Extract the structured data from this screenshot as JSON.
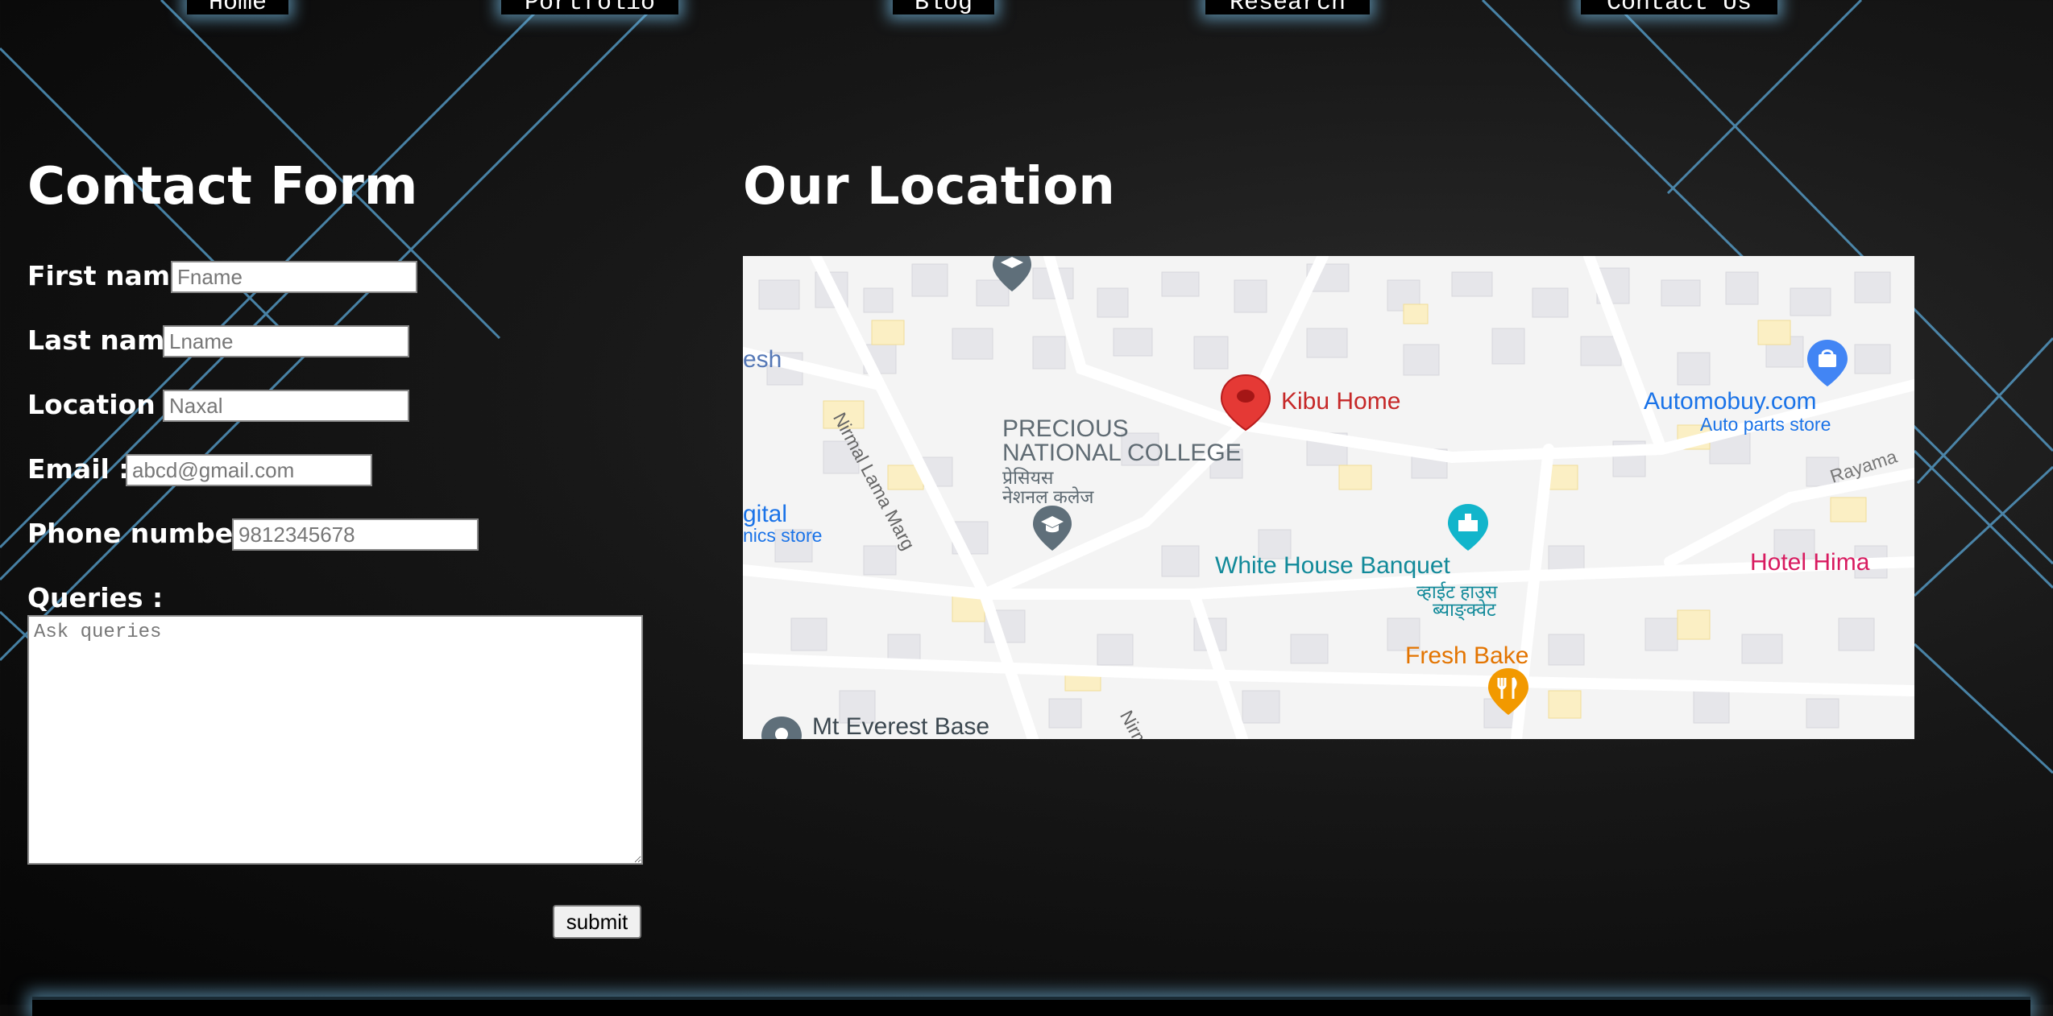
{
  "nav": {
    "items": [
      {
        "label": "Home"
      },
      {
        "label": "Portfolio"
      },
      {
        "label": "Blog"
      },
      {
        "label": "Research"
      },
      {
        "label": "Contact Us"
      }
    ]
  },
  "contact": {
    "title": "Contact Form",
    "first_name": {
      "label": "First name:",
      "placeholder": "Fname"
    },
    "last_name": {
      "label": "Last name:",
      "placeholder": "Lname"
    },
    "location": {
      "label": "Location :",
      "placeholder": "Naxal"
    },
    "email": {
      "label": "Email :",
      "placeholder": "abcd@gmail.com"
    },
    "phone": {
      "label": "Phone number :",
      "placeholder": "9812345678"
    },
    "queries": {
      "label": "Queries :",
      "placeholder": "Ask queries"
    },
    "submit_label": "submit"
  },
  "location_section": {
    "title": "Our Location",
    "map": {
      "labels": {
        "kibu_home": "Kibu Home",
        "college_en_1": "PRECIOUS",
        "college_en_2": "NATIONAL COLLEGE",
        "college_ne_1": "प्रेसियस",
        "college_ne_2": "नेशनल कलेज",
        "automobuy": "Automobuy.com",
        "automobuy_sub": "Auto parts store",
        "white_house": "White House Banquet",
        "white_house_ne_1": "व्हाईट हाउस",
        "white_house_ne_2": "ब्याङ्क्वेट",
        "hotel": "Hotel Hima",
        "fresh_bake": "Fresh Bake",
        "everest": "Mt Everest Base",
        "digital_1": "gital",
        "digital_2": "nics store",
        "esh": "esh",
        "road_nirmal": "Nirmal Lama Marg",
        "road_nirm": "Nirm",
        "road_rayama": "Rayama"
      },
      "colors": {
        "pin_red": "#e53935",
        "label_red": "#c62828",
        "poi_blue": "#1a73e8",
        "poi_teal": "#128a9a",
        "poi_orange": "#e37400",
        "poi_pink": "#d81b60",
        "poi_gray": "#5f6f7a"
      }
    }
  }
}
